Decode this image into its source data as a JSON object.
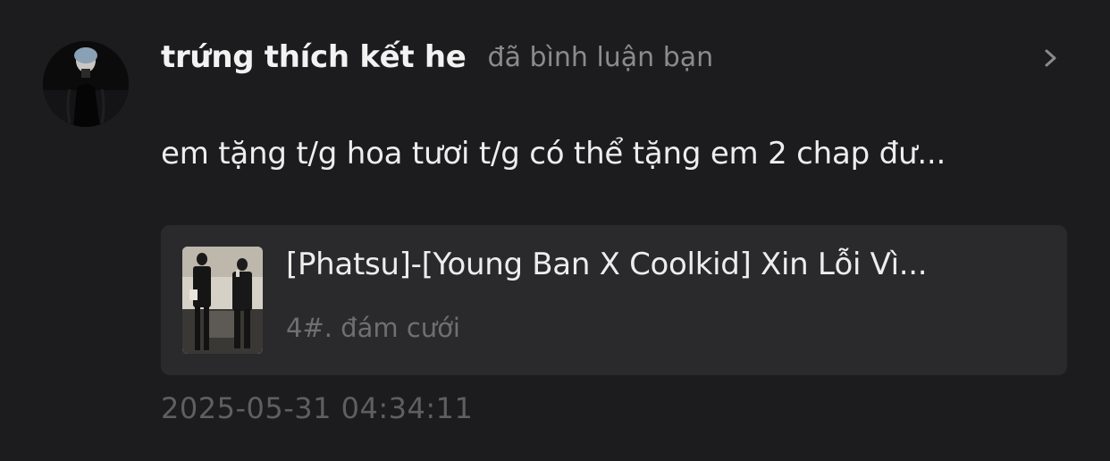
{
  "notification": {
    "user": {
      "name": "trứng thích kết he",
      "avatar_icon": "avatar-photo"
    },
    "action": "đã bình luận bạn",
    "comment": "em tặng t/g hoa tươi t/g có thể tặng em 2 chap đư...",
    "content_card": {
      "cover_icon": "comic-cover-image",
      "title": "[Phatsu]-[Young Ban X Coolkid] Xin Lỗi Vì...",
      "chapter": "4#. đám cưới"
    },
    "timestamp": "2025-05-31 04:34:11",
    "chevron_icon": "chevron-right-icon"
  },
  "colors": {
    "background": "#1c1c1e",
    "card_background": "#2a2a2c",
    "primary_text": "#f2f2f2",
    "secondary_text": "#8b8b8e",
    "muted_text": "#5f5f62"
  }
}
